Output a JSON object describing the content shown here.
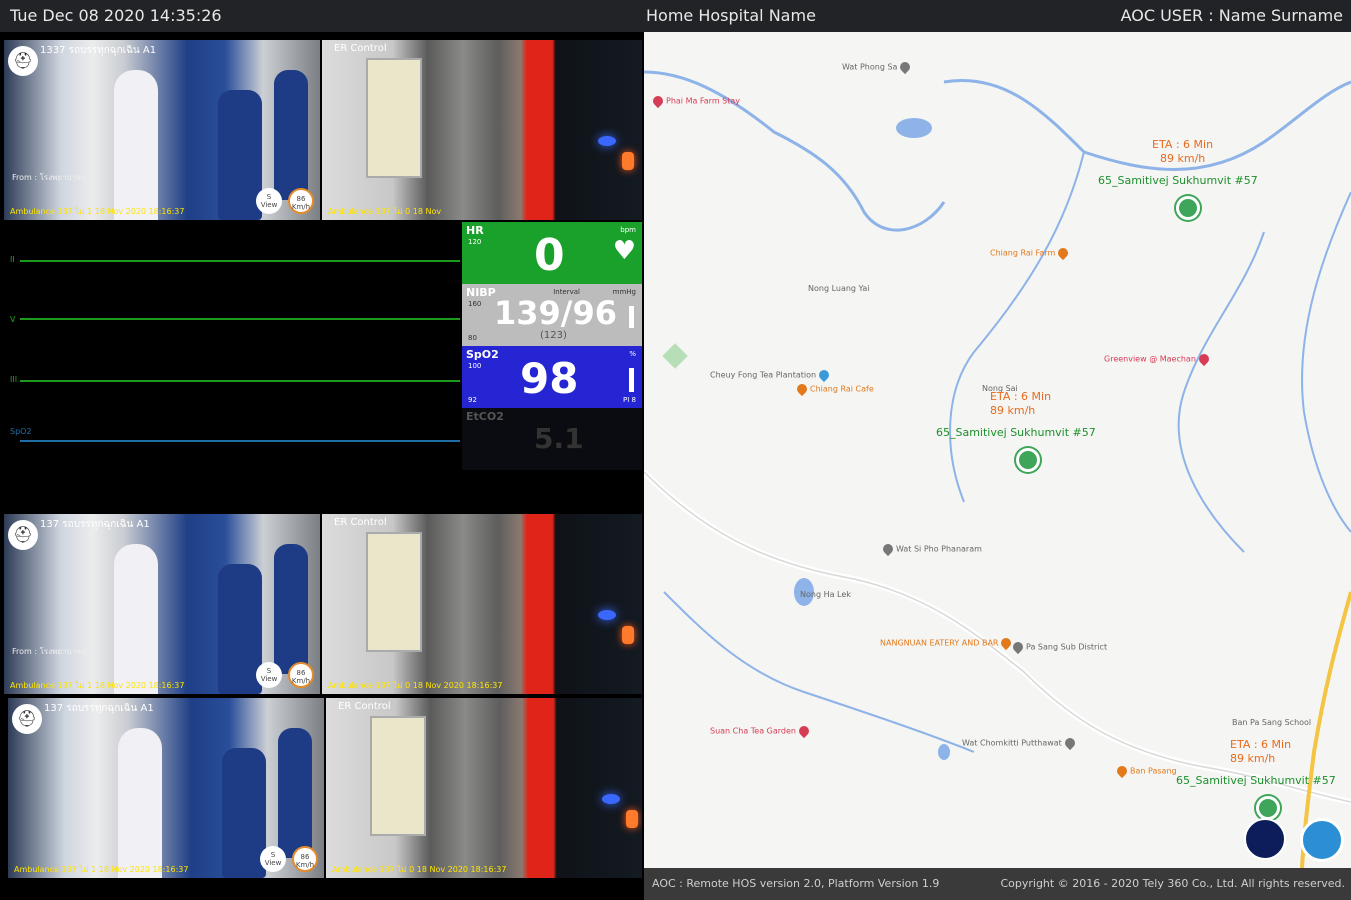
{
  "header": {
    "datetime": "Tue Dec 08 2020 14:35:26",
    "hospital": "Home Hospital Name",
    "user": "AOC USER : Name Surname"
  },
  "cameras": {
    "top_left": {
      "label": "1337 รถบรรทุกฉุกเฉิน A1",
      "from": "From : โรงพยาบาลบุ",
      "caption": "Ambulance 137 ไม่ 1 18 Nov 2020 18:16:37",
      "btn1": "S\nView",
      "btn2": "86\nKm/h"
    },
    "top_right": {
      "label": "ER Control",
      "caption": "Ambulance 137 ไม่ 0 18 Nov"
    },
    "mid_left": {
      "label": "137 รถบรรทุกฉุกเฉิน A1",
      "from": "From : โรงพยาบาลบุ",
      "caption": "Ambulance 137 ไม่ 1 18 Nov 2020 18:16:37",
      "btn1": "S\nView",
      "btn2": "86\nKm/h"
    },
    "mid_right": {
      "label": "ER Control",
      "caption": "Ambulance 137 ไม่ 0 18 Nov 2020 18:16:37"
    },
    "bot_left": {
      "label": "137 รถบรรทุกฉุกเฉิน A1",
      "caption": "Ambulance 137 ไม่ 1 18 Nov 2020 18:16:37",
      "btn1": "S\nView",
      "btn2": "86\nKm/h"
    },
    "bot_right": {
      "label": "ER Control",
      "caption": "Ambulance 137 ไม่ 0 18 Nov 2020 18:16:37"
    }
  },
  "waveforms": [
    {
      "label": "II",
      "color": "#1d9a1d"
    },
    {
      "label": "V",
      "color": "#1d9a1d"
    },
    {
      "label": "III",
      "color": "#1d9a1d"
    },
    {
      "label": "SpO2",
      "color": "#1f6fa6"
    }
  ],
  "vitals": {
    "hr": {
      "name": "HR",
      "unit": "bpm",
      "value": "0",
      "scale_top": "120",
      "heart_icon": "heart-icon",
      "color": "#1aa12b"
    },
    "nibp": {
      "name": "NIBP",
      "unit": "mmHg",
      "mode": "Interval",
      "value": "139/96",
      "mean": "(123)",
      "scale_top": "160",
      "scale_bot": "80",
      "color": "#bcbcbc"
    },
    "spo2": {
      "name": "SpO2",
      "unit": "%",
      "value": "98",
      "scale_top": "100",
      "scale_bot": "92",
      "pi": "PI 8",
      "color": "#2625d4"
    },
    "etco2": {
      "name": "EtCO2",
      "value": "5.1",
      "color": "#0b0b12"
    }
  },
  "map": {
    "eta1": {
      "eta": "ETA : 6 Min",
      "speed": "89 km/h",
      "label": "65_Samitivej Sukhumvit #57"
    },
    "eta2": {
      "eta": "ETA : 6 Min",
      "speed": "89 km/h",
      "label": "65_Samitivej Sukhumvit #57"
    },
    "eta3": {
      "eta": "ETA : 6 Min",
      "speed": "89 km/h",
      "label": "65_Samitivej Sukhumvit #57"
    },
    "pois": [
      "Phai Ma Farm Stay",
      "Wat Phong Sa",
      "Nong Luang Yai",
      "Chiang Rai Cafe",
      "Wat Si Pho Phanaram",
      "Nong Ha Lek",
      "Pa Sang Sub District",
      "Suan Cha Tea Garden",
      "NANGNUAN EATERY AND BAR",
      "Chiang Rai Farm",
      "Cheuy Fong Tea Plantation",
      "Greenview @ Maechan",
      "Ban Pa Sang School",
      "Wat Chomkitti Putthawat",
      "Ban Pasang",
      "Nong Sai"
    ]
  },
  "footer": {
    "version": "AOC : Remote HOS version 2.0, Platform Version 1.9",
    "copyright": "Copyright © 2016 - 2020 Tely 360 Co., Ltd. All rights reserved."
  }
}
